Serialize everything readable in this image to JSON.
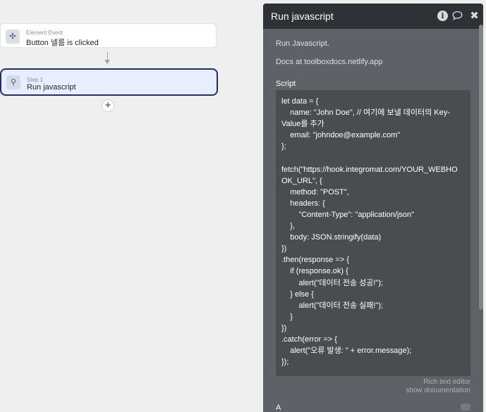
{
  "workflow": {
    "event_card": {
      "category": "Element Event",
      "name": "Button 넬름 is clicked",
      "icon": "cursor-click-icon"
    },
    "step_card": {
      "category": "Step 1",
      "name": "Run javascript",
      "icon": "plugin-icon"
    },
    "add_step_label": "+"
  },
  "panel": {
    "title": "Run javascript",
    "header_icons": {
      "info": "i",
      "comment": "💬",
      "close": "✖"
    },
    "description": "Run Javascript.",
    "docs": "Docs at toolboxdocs.netlify.app",
    "script_label": "Script",
    "code_lines": [
      "let data = {",
      "    name: \"John Doe\", // 여기에 보낼 데이터의 Key-",
      "Value를 추가",
      "    email: \"johndoe@example.com\"",
      "};",
      "",
      "fetch(\"https://hook.integromat.com/YOUR_WEBHO",
      "OK_URL\", {",
      "    method: \"POST\",",
      "    headers: {",
      "        \"Content-Type\": \"application/json\"",
      "    },",
      "    body: JSON.stringify(data)",
      "})",
      ".then(response => {",
      "    if (response.ok) {",
      "        alert(\"데이터 전송 성공!\");",
      "    } else {",
      "        alert(\"데이터 전송 실패!\");",
      "    }",
      "})",
      ".catch(error => {",
      "    alert(\"오류 발생: \" + error.message);",
      "});"
    ],
    "rich_text_editor": "Rich text editor",
    "show_documentation": "show documentation",
    "bottom_fragment": "A"
  }
}
